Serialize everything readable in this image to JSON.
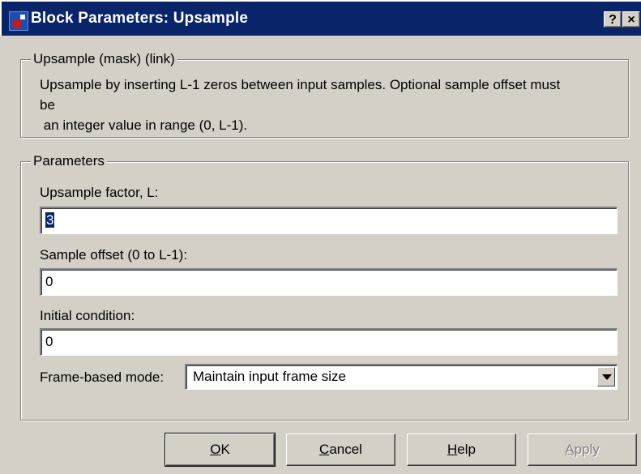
{
  "window": {
    "title": "Block Parameters: Upsample",
    "help_button": "?",
    "close_button": "×"
  },
  "mask_group": {
    "legend": "Upsample (mask) (link)",
    "description_line1": "Upsample by inserting L-1 zeros between input samples.  Optional sample offset must",
    "description_line2": "be",
    "description_line3": " an integer value in range (0, L-1)."
  },
  "params_group": {
    "legend": "Parameters",
    "upsample_factor_label": "Upsample factor, L:",
    "upsample_factor_value": "3",
    "sample_offset_label": "Sample offset (0 to L-1):",
    "sample_offset_value": "0",
    "initial_condition_label": "Initial condition:",
    "initial_condition_value": "0",
    "frame_mode_label": "Frame-based mode:",
    "frame_mode_value": "Maintain input frame size"
  },
  "buttons": {
    "ok_mnemonic": "O",
    "ok_rest": "K",
    "cancel_mnemonic": "C",
    "cancel_rest": "ancel",
    "help_mnemonic": "H",
    "help_rest": "elp",
    "apply_mnemonic": "A",
    "apply_rest": "pply"
  }
}
